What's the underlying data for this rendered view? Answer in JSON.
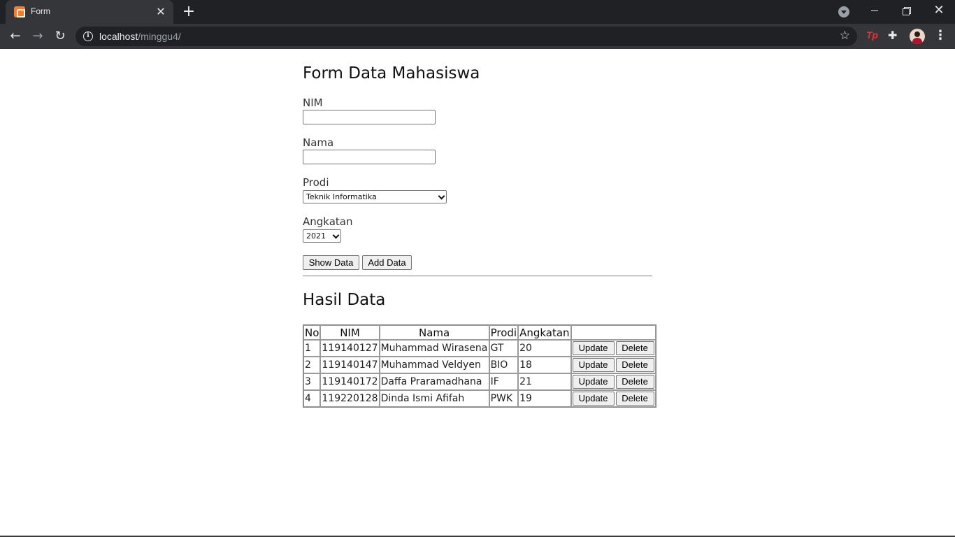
{
  "browser": {
    "tab_title": "Form",
    "tab_close": "✕",
    "new_tab": "+",
    "url_host": "localhost",
    "url_path": "/minggu4/",
    "nav_back": "←",
    "nav_forward": "→",
    "nav_reload": "↻",
    "star": "☆",
    "window_close": "✕",
    "menu": "⋮",
    "extension_tp": "Tp",
    "extension_puzzle": "✚",
    "info": "i"
  },
  "form": {
    "title": "Form Data Mahasiswa",
    "nim_label": "NIM",
    "nim_value": "",
    "nama_label": "Nama",
    "nama_value": "",
    "prodi_label": "Prodi",
    "prodi_selected": "Teknik Informatika",
    "angkatan_label": "Angkatan",
    "angkatan_selected": "2021",
    "show_button": "Show Data",
    "add_button": "Add Data"
  },
  "results": {
    "title": "Hasil Data",
    "columns": [
      "No",
      "NIM",
      "Nama",
      "Prodi",
      "Angkatan",
      ""
    ],
    "rows": [
      {
        "no": "1",
        "nim": "119140127",
        "nama": "Muhammad Wirasena",
        "prodi": "GT",
        "angkatan": "20"
      },
      {
        "no": "2",
        "nim": "119140147",
        "nama": "Muhammad Veldyen",
        "prodi": "BIO",
        "angkatan": "18"
      },
      {
        "no": "3",
        "nim": "119140172",
        "nama": "Daffa Praramadhana",
        "prodi": "IF",
        "angkatan": "21"
      },
      {
        "no": "4",
        "nim": "119220128",
        "nama": "Dinda Ismi Afifah",
        "prodi": "PWK",
        "angkatan": "19"
      }
    ],
    "update_label": "Update",
    "delete_label": "Delete"
  }
}
